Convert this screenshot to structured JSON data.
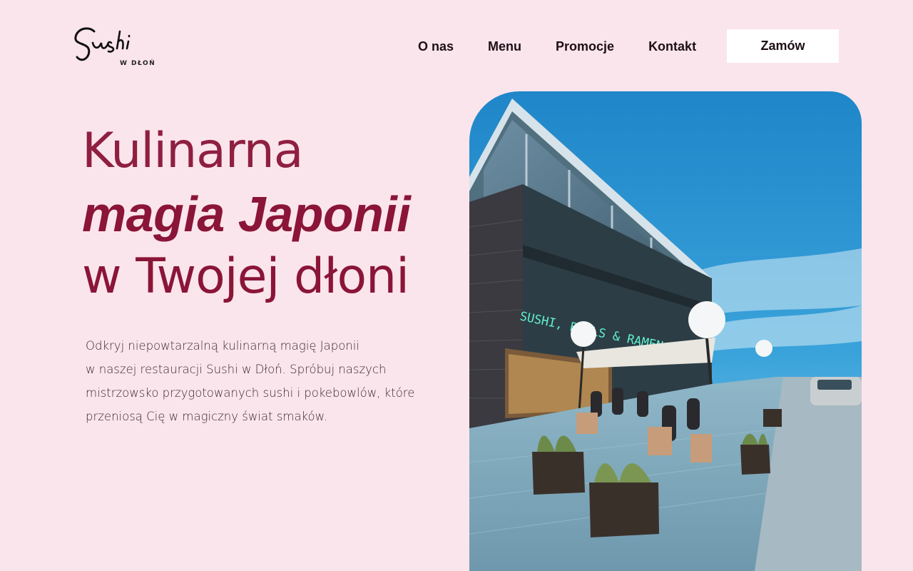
{
  "brand": {
    "logo_script": "Sushi",
    "logo_sub": "W DŁOŃ"
  },
  "nav": {
    "items": [
      {
        "label": "O nas"
      },
      {
        "label": "Menu"
      },
      {
        "label": "Promocje"
      },
      {
        "label": "Kontakt"
      }
    ],
    "order_label": "Zamów"
  },
  "hero": {
    "title_line1": "Kulinarna",
    "title_line2": "magia Japonii",
    "title_line3": "w Twojej dłoni",
    "description_lines": [
      "Odkryj niepowtarzalną kulinarną magię Japonii",
      "w naszej restauracji Sushi w Dłoń. Spróbuj naszych",
      "mistrzowsko przygotowanych sushi i pokebowlów, które",
      "przeniosą Cię w magiczny świat smaków."
    ],
    "photo_sign": "SUSHI, BOWLS & RAMEN"
  },
  "colors": {
    "background": "#fbe5ec",
    "accent": "#8a1538",
    "button_bg": "#ffffff"
  }
}
